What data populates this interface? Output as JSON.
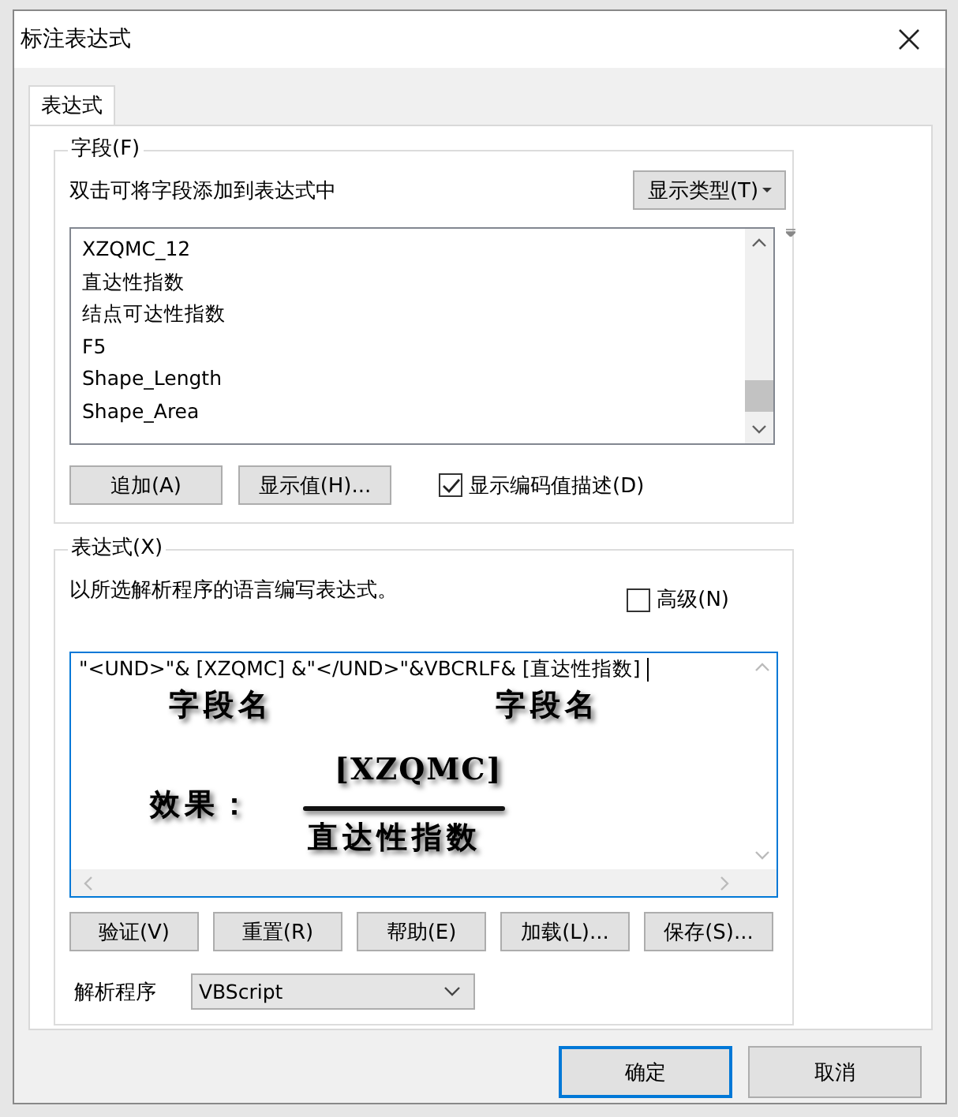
{
  "window": {
    "title": "标注表达式"
  },
  "tabs": [
    {
      "label": "表达式",
      "selected": true
    }
  ],
  "fields_group": {
    "title": "字段(F)",
    "hint": "双击可将字段添加到表达式中",
    "type_button": "显示类型(T)",
    "fields": [
      "XZQMC_12",
      "直达性指数",
      "结点可达性指数",
      "F5",
      "Shape_Length",
      "Shape_Area"
    ],
    "buttons": [
      "追加(A)",
      "显示值(H)..."
    ],
    "show_coded": {
      "label": "显示编码值描述(D)",
      "checked": true
    }
  },
  "expression_group": {
    "title": "表达式(X)",
    "hint": "以所选解析程序的语言编写表达式。",
    "advanced": {
      "label": "高级(N)",
      "checked": false
    },
    "value": "\"<UND>\"& [XZQMC] &\"</UND>\"&VBCRLF& [直达性指数]",
    "annotations": {
      "field_labels": [
        "字段名",
        "字段名"
      ],
      "effect_label": "效果：",
      "numerator": "[XZQMC]",
      "denominator": "直达性指数"
    },
    "buttons": [
      "验证(V)",
      "重置(R)",
      "帮助(E)",
      "加载(L)...",
      "保存(S)..."
    ],
    "parser": {
      "label": "解析程序",
      "value": "VBScript"
    }
  },
  "buttons": [
    {
      "label": "确定",
      "default": true
    },
    {
      "label": "取消",
      "default": false
    }
  ]
}
